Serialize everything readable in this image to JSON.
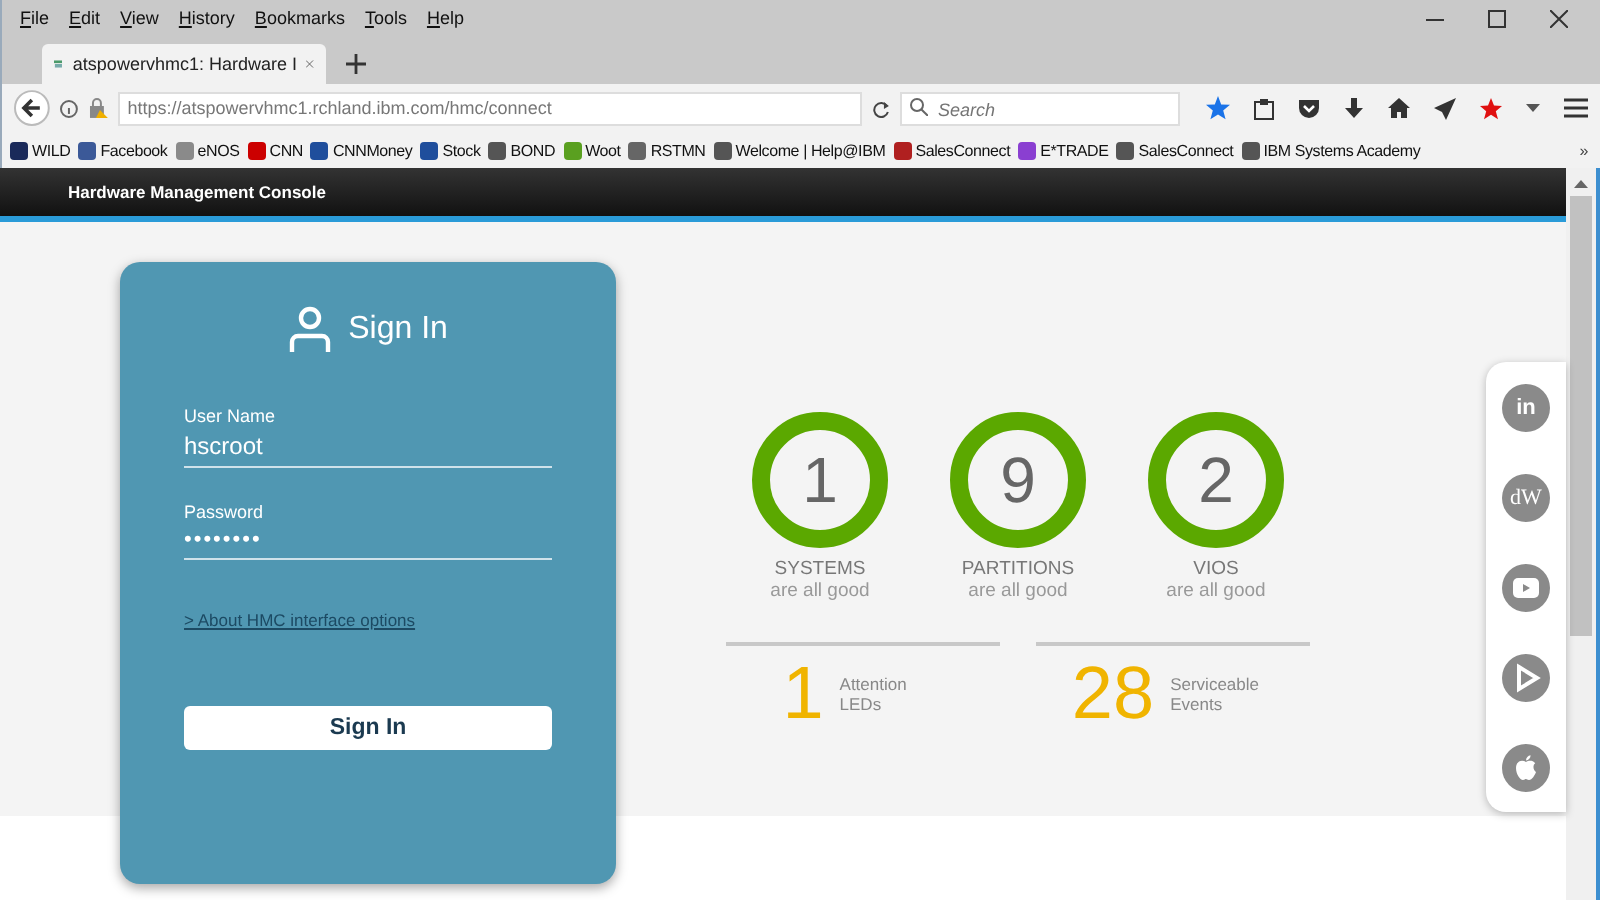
{
  "menu_bar": [
    "File",
    "Edit",
    "View",
    "History",
    "Bookmarks",
    "Tools",
    "Help"
  ],
  "tabs": [
    {
      "title": "atspowervhmc1: Hardware I",
      "selected": true
    }
  ],
  "address_bar": {
    "url": "https://atspowervhmc1.rchland.ibm.com/hmc/connect"
  },
  "search": {
    "placeholder": "Search"
  },
  "bookmarks": [
    {
      "label": "WILD",
      "color": "#1a2a5a"
    },
    {
      "label": "Facebook",
      "color": "#3b5998"
    },
    {
      "label": "eNOS",
      "color": "#8a8a8a"
    },
    {
      "label": "CNN",
      "color": "#cc0000"
    },
    {
      "label": "CNNMoney",
      "color": "#1f4e9c"
    },
    {
      "label": "Stock",
      "color": "#1f4e9c"
    },
    {
      "label": "BOND",
      "color": "#555555"
    },
    {
      "label": "Woot",
      "color": "#5aa020"
    },
    {
      "label": "RSTMN",
      "color": "#666666"
    },
    {
      "label": "Welcome | Help@IBM",
      "color": "#555555"
    },
    {
      "label": "SalesConnect",
      "color": "#b02020"
    },
    {
      "label": "E*TRADE",
      "color": "#8a3fd1"
    },
    {
      "label": "SalesConnect",
      "color": "#555555"
    },
    {
      "label": "IBM Systems Academy",
      "color": "#555555"
    }
  ],
  "bookmarks_overflow": "»",
  "app_header": {
    "title": "Hardware Management Console"
  },
  "sign_in": {
    "title": "Sign In",
    "user_label": "User Name",
    "user_value": "hscroot",
    "password_label": "Password",
    "password_value": "••••••••",
    "link": "> About HMC interface options",
    "button": "Sign In"
  },
  "stats": [
    {
      "value": "1",
      "label": "SYSTEMS",
      "status": "are all good",
      "color": "#5ba800"
    },
    {
      "value": "9",
      "label": "PARTITIONS",
      "status": "are all good",
      "color": "#5ba800"
    },
    {
      "value": "2",
      "label": "VIOS",
      "status": "are all good",
      "color": "#5ba800"
    }
  ],
  "counts": [
    {
      "value": "1",
      "label": "Attention LEDs"
    },
    {
      "value": "28",
      "label": "Serviceable Events"
    }
  ],
  "social": [
    {
      "kind": "text",
      "label": "in"
    },
    {
      "kind": "text",
      "label": "dW"
    },
    {
      "kind": "video"
    },
    {
      "kind": "play"
    },
    {
      "kind": "apple"
    }
  ]
}
